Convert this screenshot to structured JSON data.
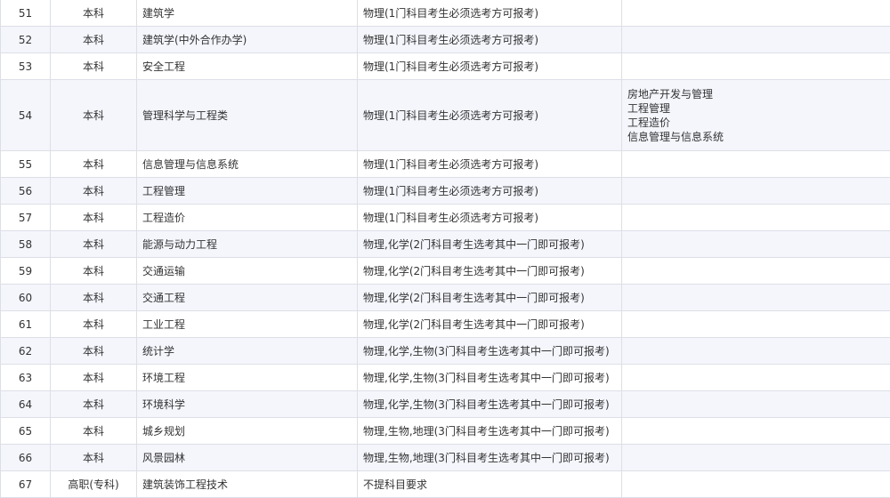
{
  "rows": [
    {
      "no": "51",
      "level": "本科",
      "major": "建筑学",
      "req": "物理(1门科目考生必须选考方可报考)",
      "notes": []
    },
    {
      "no": "52",
      "level": "本科",
      "major": "建筑学(中外合作办学)",
      "req": "物理(1门科目考生必须选考方可报考)",
      "notes": []
    },
    {
      "no": "53",
      "level": "本科",
      "major": "安全工程",
      "req": "物理(1门科目考生必须选考方可报考)",
      "notes": []
    },
    {
      "no": "54",
      "level": "本科",
      "major": "管理科学与工程类",
      "req": "物理(1门科目考生必须选考方可报考)",
      "notes": [
        "房地产开发与管理",
        "工程管理",
        "工程造价",
        "信息管理与信息系统"
      ]
    },
    {
      "no": "55",
      "level": "本科",
      "major": "信息管理与信息系统",
      "req": "物理(1门科目考生必须选考方可报考)",
      "notes": []
    },
    {
      "no": "56",
      "level": "本科",
      "major": "工程管理",
      "req": "物理(1门科目考生必须选考方可报考)",
      "notes": []
    },
    {
      "no": "57",
      "level": "本科",
      "major": "工程造价",
      "req": "物理(1门科目考生必须选考方可报考)",
      "notes": []
    },
    {
      "no": "58",
      "level": "本科",
      "major": "能源与动力工程",
      "req": "物理,化学(2门科目考生选考其中一门即可报考)",
      "notes": []
    },
    {
      "no": "59",
      "level": "本科",
      "major": "交通运输",
      "req": "物理,化学(2门科目考生选考其中一门即可报考)",
      "notes": []
    },
    {
      "no": "60",
      "level": "本科",
      "major": "交通工程",
      "req": "物理,化学(2门科目考生选考其中一门即可报考)",
      "notes": []
    },
    {
      "no": "61",
      "level": "本科",
      "major": "工业工程",
      "req": "物理,化学(2门科目考生选考其中一门即可报考)",
      "notes": []
    },
    {
      "no": "62",
      "level": "本科",
      "major": "统计学",
      "req": "物理,化学,生物(3门科目考生选考其中一门即可报考)",
      "notes": []
    },
    {
      "no": "63",
      "level": "本科",
      "major": "环境工程",
      "req": "物理,化学,生物(3门科目考生选考其中一门即可报考)",
      "notes": []
    },
    {
      "no": "64",
      "level": "本科",
      "major": "环境科学",
      "req": "物理,化学,生物(3门科目考生选考其中一门即可报考)",
      "notes": []
    },
    {
      "no": "65",
      "level": "本科",
      "major": "城乡规划",
      "req": "物理,生物,地理(3门科目考生选考其中一门即可报考)",
      "notes": []
    },
    {
      "no": "66",
      "level": "本科",
      "major": "风景园林",
      "req": "物理,生物,地理(3门科目考生选考其中一门即可报考)",
      "notes": []
    },
    {
      "no": "67",
      "level": "高职(专科)",
      "major": "建筑装饰工程技术",
      "req": "不提科目要求",
      "notes": []
    }
  ]
}
